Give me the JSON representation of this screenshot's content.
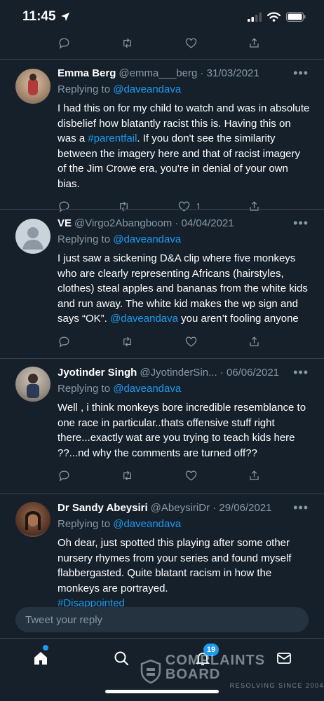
{
  "status_bar": {
    "time": "11:45"
  },
  "tweets": [
    {
      "name": "Emma Berg",
      "handle": "@emma___berg · 31/03/2021",
      "replying_prefix": "Replying to",
      "replying_to": "@daveandava",
      "text_parts": [
        "I had this on for my child to watch and was in absolute disbelief how blatantly racist this is. Having this on was a ",
        "#parentfail",
        ". If you don't see the similarity between the imagery here and that of racist imagery of the Jim Crowe era, you're in denial of your own bias."
      ],
      "like_count": "1"
    },
    {
      "name": "VE",
      "handle": "@Virgo2Abangboom · 04/04/2021",
      "replying_prefix": "Replying to",
      "replying_to": "@daveandava",
      "text_parts": [
        "I just saw a sickening D&A clip where five monkeys who are clearly representing Africans (hairstyles, clothes) steal apples and bananas from the white kids and run away. The white kid makes the wp sign and says “OK”. ",
        "@daveandava",
        " you aren’t fooling anyone"
      ],
      "like_count": ""
    },
    {
      "name": "Jyotinder Singh",
      "handle": "@JyotinderSin... · 06/06/2021",
      "replying_prefix": "Replying to",
      "replying_to": "@daveandava",
      "text_parts": [
        "Well , i think monkeys bore incredible resemblance to one race in particular..thats offensive stuff right there...exactly wat are you trying to teach kids here ??...nd why the comments are turned off??",
        "",
        ""
      ],
      "like_count": ""
    },
    {
      "name": "Dr Sandy Abeysiri",
      "handle": "@AbeysiriDr · 29/06/2021",
      "replying_prefix": "Replying to",
      "replying_to": "@daveandava",
      "text_parts": [
        "Oh dear, just spotted this playing after some other nursery rhymes from your series and found myself flabbergasted. Quite blatant racism in how the monkeys are portrayed.",
        "#Disappointed",
        ""
      ],
      "like_count": ""
    }
  ],
  "reply_box": {
    "placeholder": "Tweet your reply"
  },
  "tabbar": {
    "notifications_badge": "19"
  },
  "watermark": {
    "title": "COMPLAINTS BOARD",
    "subtitle": "RESOLVING SINCE 2004"
  },
  "colors": {
    "background": "#15202b",
    "accent": "#1d9bf0",
    "muted": "#8899a6",
    "divider": "#38444d"
  }
}
